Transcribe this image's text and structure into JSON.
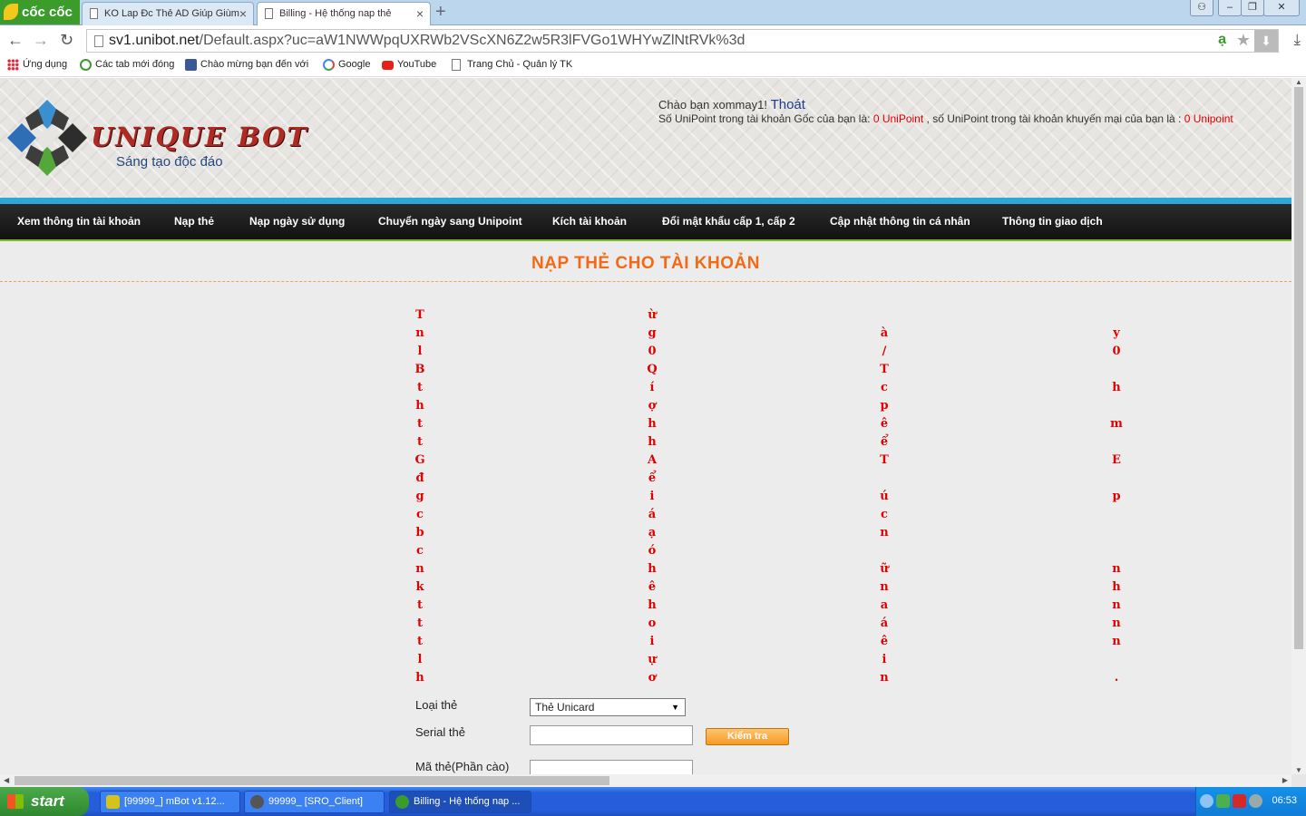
{
  "browser": {
    "brand": "cốc cốc",
    "tabs": [
      {
        "title": "KO Lap Đc Thẻ AD Giúp Giùm"
      },
      {
        "title": "Billing - Hệ thống nap thẻ"
      }
    ],
    "url_host": "sv1.unibot.net",
    "url_path": "/Default.aspx?uc=aW1NWWpqUXRWb2VScXN6Z2w5R3lFVGo1WHYwZlNtRVk%3d",
    "bookmarks": [
      {
        "label": "Ứng dụng",
        "icon": "apps-grid-icon"
      },
      {
        "label": "Các tab mới đóng",
        "icon": "recent-tabs-icon"
      },
      {
        "label": "Chào mừng bạn đến với",
        "icon": "facebook-icon"
      },
      {
        "label": "Google",
        "icon": "google-icon"
      },
      {
        "label": "YouTube",
        "icon": "youtube-icon"
      },
      {
        "label": "Trang Chủ - Quản lý TK",
        "icon": "page-icon"
      }
    ]
  },
  "header": {
    "logo_text": "UNIQUE BOT",
    "slogan": "Sáng tạo độc đáo",
    "greeting": "Chào bạn xommay1!",
    "logout": "Thoát",
    "points_prefix": "Số UniPoint trong tài khoản Gốc của bạn là:",
    "points_main": "0 UniPoint",
    "points_middle": ", số UniPoint trong tài khoản khuyến mại của bạn là :",
    "points_promo": "0 Unipoint"
  },
  "menu": [
    "Xem thông tin tài khoản",
    "Nạp thẻ",
    "Nạp ngày sử dụng",
    "Chuyển ngày sang Unipoint",
    "Kích tài khoản",
    "Đổi mật khẩu cấp 1, cấp 2",
    "Cập nhật thông tin cá nhân",
    "Thông tin giao dịch"
  ],
  "main": {
    "section_title": "NẠP THẺ CHO TÀI KHOẢN",
    "notice_columns": [
      "T\nn\nl\nB\nt\nh\nt\nt\nG\nđ\ng\nc\nb\nc\nn\nk\nt\nt\nt\nl\nh",
      "ừ\ng\n0\nQ\ní\nợ\nh\nh\nA\nể\ni\ná\nạ\nó\nh\nê\nh\no\ni\nự\nơ",
      "\nà\n/\nT\nc\np\nê\nể\nT\n\nú\nc\nn\n\nữ\nn\na\ná\nê\ni\nn",
      "\ny\n0\n\nh\n\nm\n\nE\n\np\n\n\n\nn\nh\nn\nn\nn\n\n."
    ],
    "form": {
      "card_type_label": "Loại thẻ",
      "card_type_value": "Thẻ Unicard",
      "serial_label": "Serial thẻ",
      "check_button": "Kiểm tra",
      "code_label": "Mã thẻ(Phần cào)"
    }
  },
  "taskbar": {
    "start": "start",
    "tasks": [
      {
        "label": "[99999_] mBot v1.12...",
        "icon": "mbot-icon"
      },
      {
        "label": "99999_ [SRO_Client]",
        "icon": "sro-client-icon"
      },
      {
        "label": "Billing - Hệ thống nap ...",
        "icon": "coccoc-icon"
      }
    ],
    "clock": "06:53"
  },
  "colors": {
    "accent_orange": "#f26a16",
    "menu_bg": "#1a1a1a",
    "cyan_bar": "#2ea7d8",
    "point_red": "#e00000"
  }
}
